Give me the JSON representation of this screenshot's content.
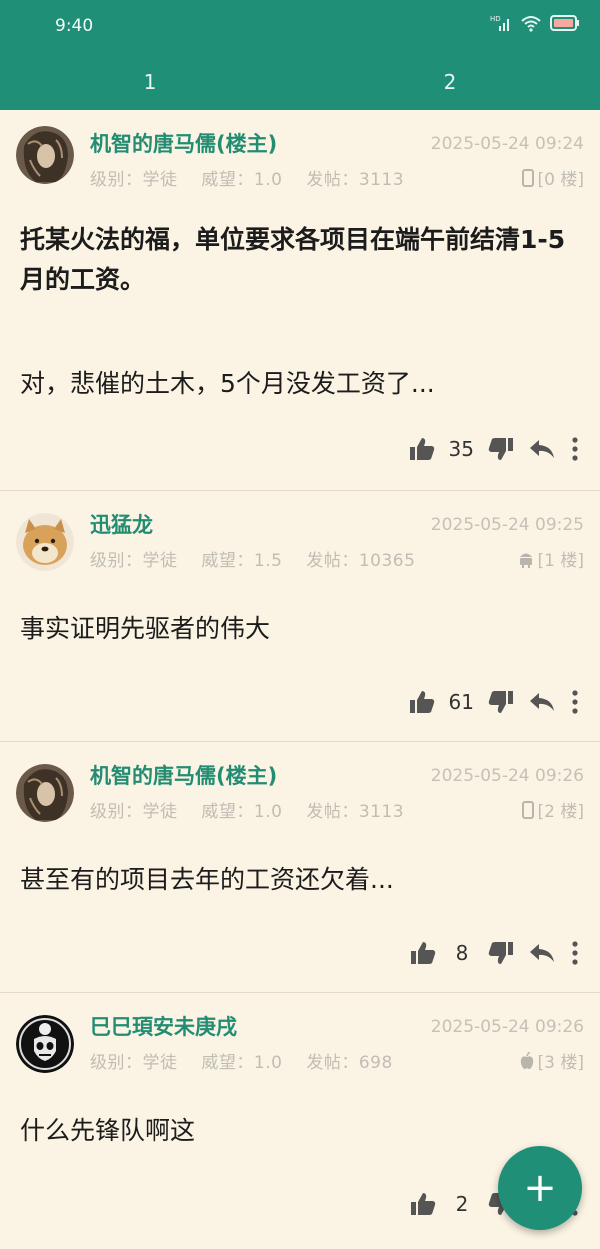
{
  "status_bar": {
    "time": "9:40",
    "hd_label": "HD"
  },
  "tabs": [
    {
      "label": "1"
    },
    {
      "label": "2"
    }
  ],
  "posts": [
    {
      "username": "机智的唐马儒(楼主)",
      "time": "2025-05-24 09:24",
      "level": "级别：学徒",
      "prestige": "威望：1.0",
      "post_count": "发帖：3113",
      "device": "phone",
      "floor": "[0 楼]",
      "text_bold": "托某火法的福，单位要求各项目在端午前结清1-5月的工资。",
      "text": "对，悲催的土木，5个月没发工资了...",
      "likes": "35"
    },
    {
      "username": "迅猛龙",
      "time": "2025-05-24 09:25",
      "level": "级别：学徒",
      "prestige": "威望：1.5",
      "post_count": "发帖：10365",
      "device": "android",
      "floor": "[1 楼]",
      "text": "事实证明先驱者的伟大",
      "likes": "61"
    },
    {
      "username": "机智的唐马儒(楼主)",
      "time": "2025-05-24 09:26",
      "level": "级别：学徒",
      "prestige": "威望：1.0",
      "post_count": "发帖：3113",
      "device": "phone",
      "floor": "[2 楼]",
      "text": "甚至有的项目去年的工资还欠着...",
      "likes": "8"
    },
    {
      "username": "巳巳頊安未庚戌",
      "time": "2025-05-24 09:26",
      "level": "级别：学徒",
      "prestige": "威望：1.0",
      "post_count": "发帖：698",
      "device": "apple",
      "floor": "[3 楼]",
      "text": "什么先锋队啊这",
      "likes": "2"
    }
  ],
  "fab": {
    "label": "+"
  },
  "colors": {
    "accent": "#1f8f78",
    "background": "#fbf4e4",
    "username": "#238d73"
  }
}
